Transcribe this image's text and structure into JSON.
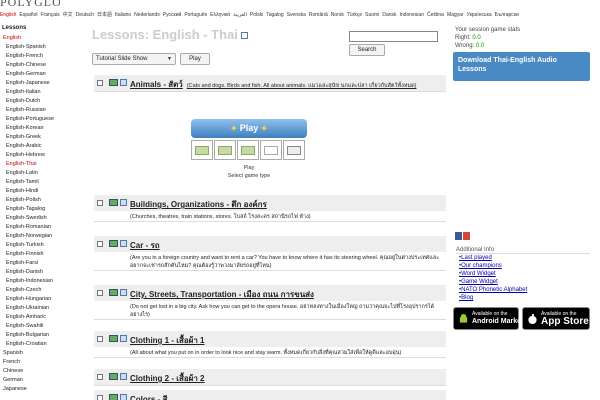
{
  "logo": "POLYGLOT",
  "languages": [
    "English",
    "Español",
    "Français",
    "中文",
    "Deutsch",
    "日本語",
    "Italiano",
    "Nederlands",
    "Русский",
    "Português",
    "Ελληνικά",
    "العربية",
    "Polski",
    "Tagalog",
    "Svenska",
    "Română",
    "Norsk",
    "Türkçe",
    "Suomi",
    "Dansk",
    "Indonesian",
    "Čeština",
    "Magyar",
    "Українська",
    "Български"
  ],
  "active_language": "English",
  "sidebar": {
    "heading": "Lessons",
    "items": [
      {
        "label": "English",
        "type": "top",
        "active": true
      },
      {
        "label": "English-Spanish",
        "type": "sub"
      },
      {
        "label": "English-French",
        "type": "sub"
      },
      {
        "label": "English-Chinese",
        "type": "sub"
      },
      {
        "label": "English-German",
        "type": "sub"
      },
      {
        "label": "English-Japanese",
        "type": "sub"
      },
      {
        "label": "English-Italian",
        "type": "sub"
      },
      {
        "label": "English-Dutch",
        "type": "sub"
      },
      {
        "label": "English-Russian",
        "type": "sub"
      },
      {
        "label": "English-Portuguese",
        "type": "sub"
      },
      {
        "label": "English-Korean",
        "type": "sub"
      },
      {
        "label": "English-Greek",
        "type": "sub"
      },
      {
        "label": "English-Arabic",
        "type": "sub"
      },
      {
        "label": "English-Hebrew",
        "type": "sub"
      },
      {
        "label": "English-Thai",
        "type": "sub",
        "active": true
      },
      {
        "label": "English-Latin",
        "type": "sub"
      },
      {
        "label": "English-Tamil",
        "type": "sub"
      },
      {
        "label": "English-Hindi",
        "type": "sub"
      },
      {
        "label": "English-Polish",
        "type": "sub"
      },
      {
        "label": "English-Tagalog",
        "type": "sub"
      },
      {
        "label": "English-Swedish",
        "type": "sub"
      },
      {
        "label": "English-Romanian",
        "type": "sub"
      },
      {
        "label": "English-Norwegian",
        "type": "sub"
      },
      {
        "label": "English-Turkish",
        "type": "sub"
      },
      {
        "label": "English-Finnish",
        "type": "sub"
      },
      {
        "label": "English-Farsi",
        "type": "sub"
      },
      {
        "label": "English-Danish",
        "type": "sub"
      },
      {
        "label": "English-Indonesian",
        "type": "sub"
      },
      {
        "label": "English-Czech",
        "type": "sub"
      },
      {
        "label": "English-Hungarian",
        "type": "sub"
      },
      {
        "label": "English-Ukrainian",
        "type": "sub"
      },
      {
        "label": "English-Amharic",
        "type": "sub"
      },
      {
        "label": "English-Swahili",
        "type": "sub"
      },
      {
        "label": "English-Bulgarian",
        "type": "sub"
      },
      {
        "label": "English-Croatian",
        "type": "sub"
      },
      {
        "label": "Spanish",
        "type": "top"
      },
      {
        "label": "French",
        "type": "top"
      },
      {
        "label": "Chinese",
        "type": "top"
      },
      {
        "label": "German",
        "type": "top"
      },
      {
        "label": "Japanese",
        "type": "top"
      }
    ]
  },
  "page_title": "Lessons: English - Thai",
  "controls": {
    "slideshow_value": "Tutorial Slide Show",
    "play_label": "Play"
  },
  "search": {
    "placeholder": "",
    "button_label": "Search"
  },
  "stats": {
    "heading": "Your session game stats",
    "right_label": "Right:",
    "right_value": "0.0",
    "wrong_label": "Wrong:",
    "wrong_value": "0.0"
  },
  "download": "Download Thai-English Audio Lessons",
  "lessons": [
    {
      "title": "Animals - สัตว์",
      "desc": "(Cats and dogs. Birds and fish. All about animals. แมวและสุนัข นกและปลา เกี่ยวกับสัตว์ทั้งหมด)"
    },
    {
      "title": "Buildings, Organizations - ตึก องค์กร",
      "desc": "(Churches, theatres, train stations, stores. โบสถ์ โรงละคร สถานีรถไฟ ห้าง)"
    },
    {
      "title": "Car - รถ",
      "desc": "(Are you in a foreign country and want to rent a car? You have to know where it has its steering wheel. คุณอยู่ในต่างประเทศและอยากจะเช่ารถสักคันไหม? คุณต้องรู้ว่าพวงมาลัยรถอยู่ที่ไหน)"
    },
    {
      "title": "City, Streets, Transportation - เมือง ถนน การขนส่ง",
      "desc": "(Do not get lost in a big city. Ask how you can get to the opera house. อย่าหลงทางในเมืองใหญ่ ถามว่าคุณจะไปที่โรงอุปรากรได้อย่างไร)"
    },
    {
      "title": "Clothing 1 - เสื้อผ้า 1",
      "desc": "(All about what you put on in order to look nice and stay warm. ทั้งหมดเกี่ยวกับสิ่งที่คุณสวมใส่เพื่อให้ดูดีและอบอุ่น)"
    },
    {
      "title": "Clothing 2 - เสื้อผ้า 2",
      "desc": ""
    },
    {
      "title": "Colors - สี",
      "desc": ""
    }
  ],
  "play_widget": {
    "button": "Play",
    "label": "Play",
    "select_label": "Select game type"
  },
  "additional_info": {
    "heading": "Additional Info",
    "links": [
      "Last played",
      "Our champions",
      "Word Widget",
      "Game Widget",
      "NATO Phonetic Alphabet",
      "Blog"
    ]
  },
  "stores": {
    "android_small": "Available on the",
    "android_big": "Android Market",
    "apple_small": "Available on the",
    "apple_big": "App Store"
  }
}
